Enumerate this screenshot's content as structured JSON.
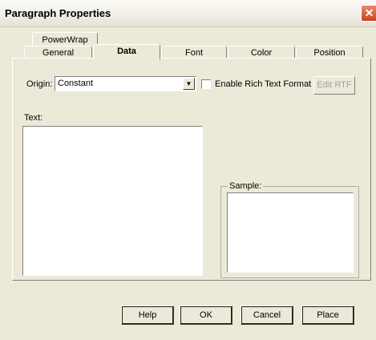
{
  "window": {
    "title": "Paragraph Properties",
    "close_glyph": "✕"
  },
  "tabs": {
    "row1": [
      {
        "label": "PowerWrap"
      }
    ],
    "row2": [
      {
        "label": "General"
      },
      {
        "label": "Data",
        "active": true
      },
      {
        "label": "Font"
      },
      {
        "label": "Color"
      },
      {
        "label": "Position"
      }
    ]
  },
  "data_tab": {
    "origin_label": "Origin:",
    "origin_value": "Constant",
    "dropdown_arrow": "▼",
    "rich_text_label": "Enable Rich Text Format",
    "rich_text_checked": false,
    "edit_rtf_label": "Edit RTF",
    "text_label": "Text:",
    "text_value": "",
    "sample_label": "Sample:"
  },
  "buttons": {
    "help": "Help",
    "ok": "OK",
    "cancel": "Cancel",
    "place": "Place"
  },
  "colors": {
    "dialog_bg": "#ece9d8",
    "close_button": "#c8421f"
  },
  "icons": {
    "close": "close-icon",
    "dropdown": "chevron-down-icon"
  }
}
